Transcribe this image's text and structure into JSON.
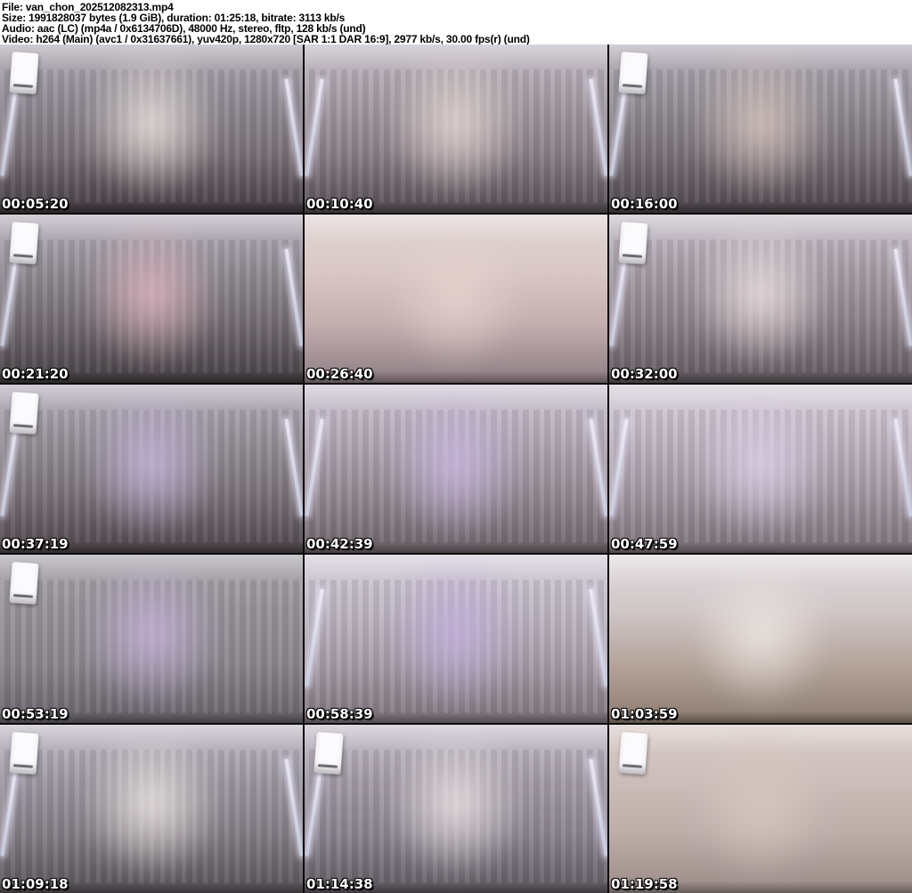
{
  "header": {
    "lines": [
      "File: van_chon_202512082313.mp4",
      "Size: 1991828037 bytes (1.9 GiB), duration: 01:25:18, bitrate: 3113 kb/s",
      "Audio: aac (LC) (mp4a / 0x6134706D), 48000 Hz, stereo, fltp, 128 kb/s (und)",
      "Video: h264 (Main) (avc1 / 0x31637661), yuv420p, 1280x720 [SAR 1:1 DAR 16:9], 2977 kb/s, 30.00 fps(r) (und)"
    ]
  },
  "colors": {
    "header_bg": "#ffffff",
    "header_text": "#000000",
    "separator": "#0b0b0b",
    "timestamp_text": "#ffffff",
    "timestamp_outline": "#000000"
  },
  "thumbnails": [
    {
      "time": "00:05:20",
      "colors": [
        "#b3abb6",
        "#8f8b93",
        "#7b7177",
        "#413a3f"
      ],
      "accent": "#efe6e2",
      "ac_unit": true,
      "led_strips": true,
      "curtain": true
    },
    {
      "time": "00:10:40",
      "colors": [
        "#c2bac4",
        "#a59ca4",
        "#8b8088",
        "#544c52"
      ],
      "accent": "#e8dcd6",
      "ac_unit": false,
      "led_strips": true,
      "curtain": true
    },
    {
      "time": "00:16:00",
      "colors": [
        "#b6aeb9",
        "#949097",
        "#7a7278",
        "#4b4449"
      ],
      "accent": "#d9c7c0",
      "ac_unit": true,
      "led_strips": true,
      "curtain": true
    },
    {
      "time": "00:21:20",
      "colors": [
        "#b9b2be",
        "#908c93",
        "#736c71",
        "#433d41"
      ],
      "accent": "#e3b8c4",
      "ac_unit": true,
      "led_strips": true,
      "curtain": true
    },
    {
      "time": "00:26:40",
      "colors": [
        "#e0d5d3",
        "#d9c7c5",
        "#c5afb0",
        "#8d7d83"
      ],
      "accent": "#e6d4cf",
      "ac_unit": false,
      "led_strips": false,
      "curtain": false
    },
    {
      "time": "00:32:00",
      "colors": [
        "#cac2cd",
        "#a79ea6",
        "#8d8289",
        "#60575d"
      ],
      "accent": "#efe4e6",
      "ac_unit": true,
      "led_strips": true,
      "curtain": true
    },
    {
      "time": "00:37:19",
      "colors": [
        "#b7b0bd",
        "#959097",
        "#7b7379",
        "#4c4449"
      ],
      "accent": "#c9b8e0",
      "ac_unit": true,
      "led_strips": true,
      "curtain": true
    },
    {
      "time": "00:42:39",
      "colors": [
        "#cdc5d3",
        "#b2a8b5",
        "#968b94",
        "#6c6268"
      ],
      "accent": "#cbb9e2",
      "ac_unit": false,
      "led_strips": true,
      "curtain": true
    },
    {
      "time": "00:47:59",
      "colors": [
        "#d7d0db",
        "#bfb5c1",
        "#a49aa4",
        "#7b7078"
      ],
      "accent": "#ded2ea",
      "ac_unit": false,
      "led_strips": true,
      "curtain": true
    },
    {
      "time": "00:53:19",
      "colors": [
        "#aaa6ac",
        "#979399",
        "#8b878d",
        "#676169"
      ],
      "accent": "#c9b4dd",
      "ac_unit": true,
      "led_strips": false,
      "curtain": true
    },
    {
      "time": "00:58:39",
      "colors": [
        "#d4cdd9",
        "#bfb7c3",
        "#a89ea9",
        "#7e737a"
      ],
      "accent": "#c3b0de",
      "ac_unit": false,
      "led_strips": true,
      "curtain": true
    },
    {
      "time": "01:03:59",
      "colors": [
        "#e1dadd",
        "#d0c6c7",
        "#b5a59c",
        "#8b7b6f"
      ],
      "accent": "#efe8e4",
      "ac_unit": false,
      "led_strips": false,
      "curtain": false
    },
    {
      "time": "01:09:18",
      "colors": [
        "#c1bbc7",
        "#9c98a1",
        "#847e86",
        "#565156"
      ],
      "accent": "#f0e9e6",
      "ac_unit": true,
      "led_strips": true,
      "curtain": true
    },
    {
      "time": "01:14:38",
      "colors": [
        "#c7c0cc",
        "#a39ba6",
        "#8c8591",
        "#5f5860"
      ],
      "accent": "#efe7e8",
      "ac_unit": true,
      "led_strips": true,
      "curtain": true
    },
    {
      "time": "01:19:58",
      "colors": [
        "#d9ccc8",
        "#ccbdb9",
        "#beada9",
        "#9b8b87"
      ],
      "accent": "#d9c8c2",
      "ac_unit": true,
      "led_strips": false,
      "curtain": false
    }
  ]
}
